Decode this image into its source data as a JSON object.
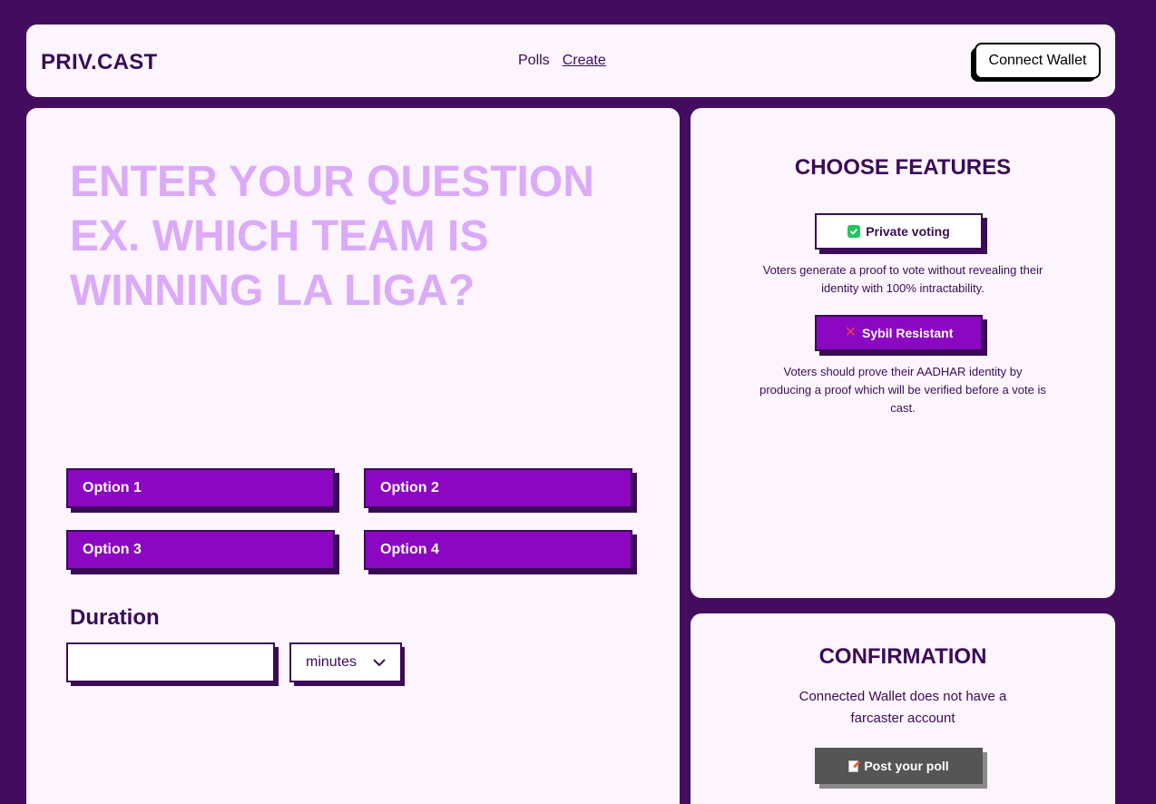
{
  "header": {
    "logo": "PRIV.CAST",
    "nav": [
      {
        "label": "Polls",
        "active": false
      },
      {
        "label": "Create",
        "active": true
      }
    ],
    "connect_wallet_label": "Connect Wallet"
  },
  "create": {
    "question_placeholder": "ENTER YOUR QUESTION EX. WHICH TEAM IS WINNING LA LIGA?",
    "options": [
      {
        "placeholder": "Option 1"
      },
      {
        "placeholder": "Option 2"
      },
      {
        "placeholder": "Option 3"
      },
      {
        "placeholder": "Option 4"
      }
    ],
    "duration_label": "Duration",
    "duration_value": "",
    "duration_unit": "minutes"
  },
  "features": {
    "title": "CHOOSE FEATURES",
    "items": [
      {
        "label": "Private voting",
        "enabled": true,
        "icon": "check-icon",
        "description": "Voters generate a proof to vote without revealing their identity with 100% intractability."
      },
      {
        "label": "Sybil Resistant",
        "enabled": false,
        "icon": "cross-icon",
        "description": "Voters should prove their AADHAR identity by producing a proof which will be verified before a vote is cast."
      }
    ]
  },
  "confirmation": {
    "title": "CONFIRMATION",
    "message": "Connected Wallet does not have a farcaster account",
    "post_label": "Post your poll",
    "post_icon": "memo-icon"
  },
  "colors": {
    "background": "#430c5e",
    "panel": "#fcf5fd",
    "accent": "#8c07c2",
    "dark": "#3b0b57",
    "placeholder": "#dbaaf8",
    "disabled": "#555555"
  }
}
